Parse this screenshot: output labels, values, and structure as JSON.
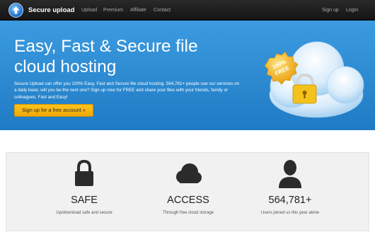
{
  "navbar": {
    "brand": "Secure upload",
    "links": [
      "Upload",
      "Premium",
      "Affiliate",
      "Contact"
    ],
    "right_links": [
      "Sign up",
      "Login"
    ]
  },
  "hero": {
    "title": "Easy, Fast & Secure file cloud hosting",
    "text": "Secure Upload can offer you 100% Easy, Fast and Secure file cloud hosting. 564,781+ people use our services on a daily base; will you be the next one? Sign up now for FREE and share your files with your friends, family or colleagues. Fast and Easy!",
    "cta": "Sign up for a free account »",
    "badge": "100% FREE"
  },
  "features": [
    {
      "icon": "lock-icon",
      "title": "SAFE",
      "desc": "Up/download safe and secure"
    },
    {
      "icon": "cloud-icon",
      "title": "ACCESS",
      "desc": "Through free cloud storage"
    },
    {
      "icon": "user-icon",
      "title": "564,781+",
      "desc": "Users joined us this year alone"
    }
  ],
  "colors": {
    "navbar": "#1c1c1c",
    "hero": "#2a88d1",
    "cta": "#f7b512",
    "features_bg": "#f1f1f1"
  }
}
